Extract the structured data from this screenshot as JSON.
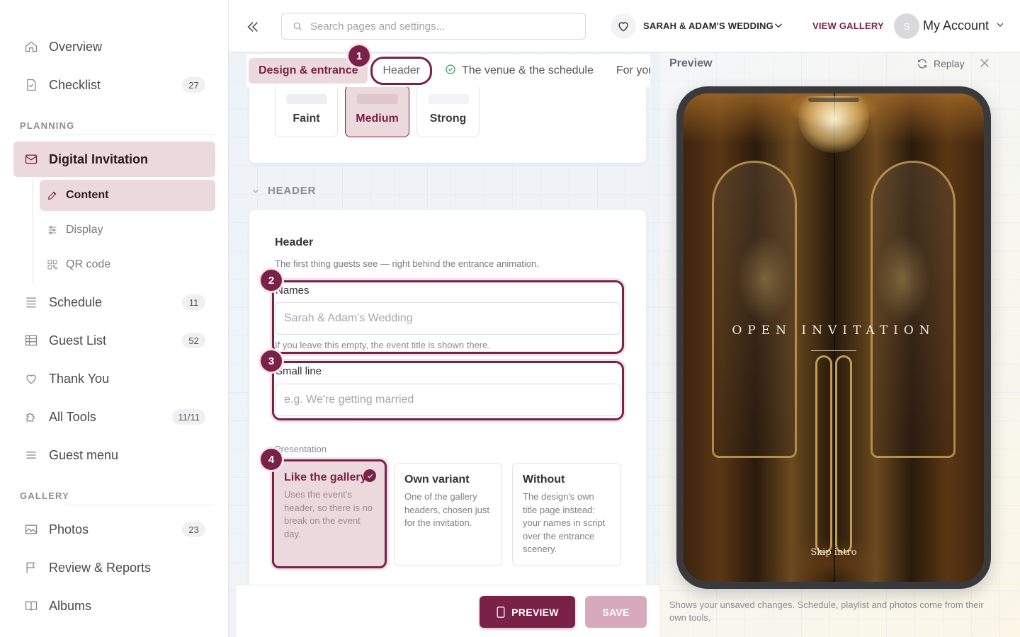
{
  "sidebar": {
    "items": [
      {
        "label": "Overview",
        "icon": "home-icon"
      },
      {
        "label": "Checklist",
        "icon": "checklist-icon",
        "badge": "27"
      }
    ],
    "planning_label": "PLANNING",
    "digital_invitation": {
      "label": "Digital Invitation",
      "icon": "envelope-icon"
    },
    "sub_items": [
      {
        "label": "Content",
        "icon": "edit-icon"
      },
      {
        "label": "Display",
        "icon": "sliders-icon"
      },
      {
        "label": "QR code",
        "icon": "qr-icon"
      }
    ],
    "planning_items": [
      {
        "label": "Schedule",
        "icon": "list-icon",
        "badge": "11"
      },
      {
        "label": "Guest List",
        "icon": "table-icon",
        "badge": "52"
      },
      {
        "label": "Thank You",
        "icon": "heart-icon"
      },
      {
        "label": "All Tools",
        "icon": "puzzle-icon",
        "badge": "11/11"
      },
      {
        "label": "Guest menu",
        "icon": "menu-icon"
      }
    ],
    "gallery_label": "GALLERY",
    "gallery_items": [
      {
        "label": "Photos",
        "icon": "image-icon",
        "badge": "23"
      },
      {
        "label": "Review & Reports",
        "icon": "flag-icon"
      },
      {
        "label": "Albums",
        "icon": "book-icon"
      }
    ]
  },
  "topbar": {
    "search_placeholder": "Search pages and settings...",
    "event_name": "SARAH & ADAM'S WEDDING",
    "view_gallery": "VIEW GALLERY",
    "avatar_initial": "S",
    "account_label": "My Account"
  },
  "tabs": {
    "design": "Design & entrance",
    "header": "Header",
    "venue": "The venue & the schedule",
    "guests": "For your gu"
  },
  "intensity": {
    "options": [
      "Faint",
      "Medium",
      "Strong"
    ],
    "selected": "Medium"
  },
  "header_section": {
    "section_title": "HEADER",
    "title": "Header",
    "description": "The first thing guests see — right behind the entrance animation.",
    "names_label": "Names",
    "names_placeholder": "Sarah & Adam's Wedding",
    "names_hint": "If you leave this empty, the event title is shown there.",
    "small_line_label": "Small line",
    "small_line_placeholder": "e.g. We're getting married",
    "presentation_label": "Presentation",
    "presentation_options": [
      {
        "title": "Like the gallery",
        "desc": "Uses the event's header, so there is no break on the event day."
      },
      {
        "title": "Own variant",
        "desc": "One of the gallery headers, chosen just for the invitation."
      },
      {
        "title": "Without",
        "desc": "The design's own title page instead: your names in script over the entrance scenery."
      }
    ],
    "presentation_selected": "Like the gallery"
  },
  "markers": [
    "1",
    "2",
    "3",
    "4"
  ],
  "footer": {
    "preview_button": "PREVIEW",
    "save_button": "SAVE"
  },
  "preview": {
    "title": "Preview",
    "replay": "Replay",
    "invite_text": "OPEN INVITATION",
    "skip_intro": "Skip intro",
    "note": "Shows your unsaved changes. Schedule, playlist and photos come from their own tools."
  },
  "colors": {
    "accent": "#7a2148",
    "accent_light": "#ecd9de",
    "success": "#2e9e58"
  }
}
